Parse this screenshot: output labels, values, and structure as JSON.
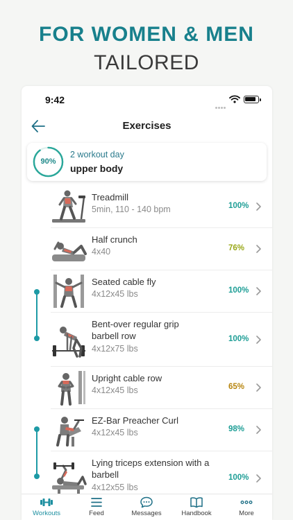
{
  "promo": {
    "title": "FOR WOMEN & MEN",
    "subtitle": "TAILORED"
  },
  "status_bar": {
    "time": "9:42"
  },
  "header": {
    "title": "Exercises"
  },
  "workout_day": {
    "label": "2 workout day",
    "name": "upper body",
    "progress_text": "90%",
    "progress": 0.9
  },
  "exercises": [
    {
      "name": "Treadmill",
      "detail": "5min, 110 - 140 bpm",
      "percent": "100%",
      "color": "#1e9e96"
    },
    {
      "name": "Half crunch",
      "detail": "4x40",
      "percent": "76%",
      "color": "#9aa81a"
    },
    {
      "name": "Seated cable fly",
      "detail": "4x12x45 lbs",
      "percent": "100%",
      "color": "#1e9e96"
    },
    {
      "name": "Bent-over regular grip barbell row",
      "detail": "4x12x75 lbs",
      "percent": "100%",
      "color": "#1e9e96"
    },
    {
      "name": "Upright cable row",
      "detail": "4x12x45 lbs",
      "percent": "65%",
      "color": "#b7850f"
    },
    {
      "name": "EZ-Bar Preacher Curl",
      "detail": "4x12x45 lbs",
      "percent": "98%",
      "color": "#1e9e96"
    },
    {
      "name": "Lying triceps extension with a barbell",
      "detail": "4x12x55 lbs",
      "percent": "100%",
      "color": "#1e9e96"
    }
  ],
  "tabs": [
    {
      "label": "Workouts",
      "icon": "dumbbell-icon",
      "active": true
    },
    {
      "label": "Feed",
      "icon": "feed-icon",
      "active": false
    },
    {
      "label": "Messages",
      "icon": "messages-icon",
      "active": false
    },
    {
      "label": "Handbook",
      "icon": "handbook-icon",
      "active": false
    },
    {
      "label": "More",
      "icon": "more-icon",
      "active": false
    }
  ],
  "colors": {
    "accent": "#1d8fa0",
    "brand": "#18808c"
  }
}
